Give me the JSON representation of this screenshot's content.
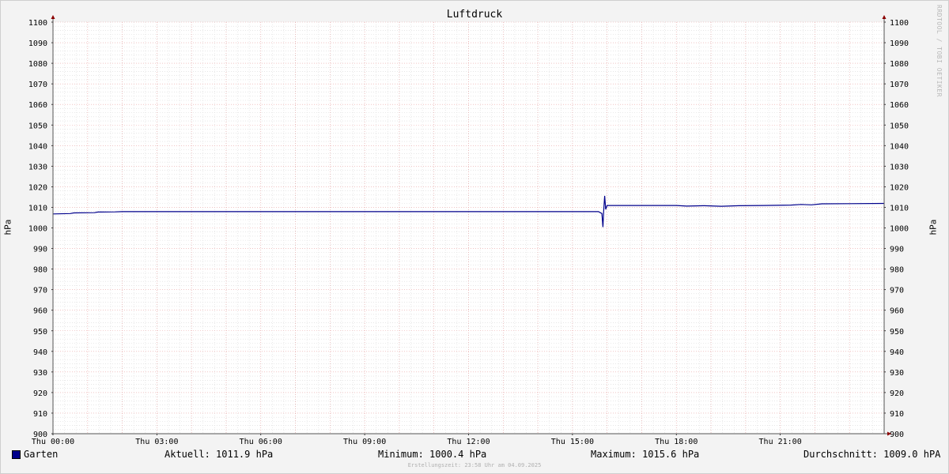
{
  "chart_data": {
    "type": "line",
    "title": "Luftdruck",
    "ylabel": "hPa",
    "ylim": [
      900,
      1100
    ],
    "y_ticks": [
      900,
      910,
      920,
      930,
      940,
      950,
      960,
      970,
      980,
      990,
      1000,
      1010,
      1020,
      1030,
      1040,
      1050,
      1060,
      1070,
      1080,
      1090,
      1100
    ],
    "xlim_hours": [
      0,
      24
    ],
    "x_ticks": [
      {
        "h": 0,
        "label": "Thu 00:00"
      },
      {
        "h": 3,
        "label": "Thu 03:00"
      },
      {
        "h": 6,
        "label": "Thu 06:00"
      },
      {
        "h": 9,
        "label": "Thu 09:00"
      },
      {
        "h": 12,
        "label": "Thu 12:00"
      },
      {
        "h": 15,
        "label": "Thu 15:00"
      },
      {
        "h": 18,
        "label": "Thu 18:00"
      },
      {
        "h": 21,
        "label": "Thu 21:00"
      }
    ],
    "grid": true,
    "series": [
      {
        "name": "Garten",
        "color": "#00008b",
        "points": [
          [
            0.0,
            1006.8
          ],
          [
            0.5,
            1007.0
          ],
          [
            0.6,
            1007.3
          ],
          [
            1.2,
            1007.4
          ],
          [
            1.3,
            1007.7
          ],
          [
            1.8,
            1007.8
          ],
          [
            2.0,
            1007.9
          ],
          [
            5.0,
            1007.9
          ],
          [
            10.0,
            1007.9
          ],
          [
            14.0,
            1007.9
          ],
          [
            15.75,
            1007.9
          ],
          [
            15.85,
            1007.0
          ],
          [
            15.88,
            1000.4
          ],
          [
            15.9,
            1008.0
          ],
          [
            15.93,
            1015.6
          ],
          [
            15.96,
            1009.0
          ],
          [
            16.0,
            1010.9
          ],
          [
            17.0,
            1010.9
          ],
          [
            18.0,
            1010.9
          ],
          [
            18.3,
            1010.6
          ],
          [
            18.8,
            1010.8
          ],
          [
            19.3,
            1010.5
          ],
          [
            19.8,
            1010.8
          ],
          [
            20.5,
            1010.9
          ],
          [
            21.3,
            1011.1
          ],
          [
            21.6,
            1011.4
          ],
          [
            21.9,
            1011.2
          ],
          [
            22.2,
            1011.7
          ],
          [
            23.0,
            1011.8
          ],
          [
            24.0,
            1011.9
          ]
        ]
      }
    ]
  },
  "watermark": "RRDTOOL / TOBI OETIKER",
  "legend": {
    "series_name": "Garten",
    "current": "Aktuell: 1011.9 hPa",
    "minimum": "Minimum: 1000.4 hPa",
    "maximum": "Maximum: 1015.6 hPa",
    "average": "Durchschnitt: 1009.0 hPA"
  },
  "created": "Erstellungszeit: 23:58 Uhr am 04.09.2025"
}
